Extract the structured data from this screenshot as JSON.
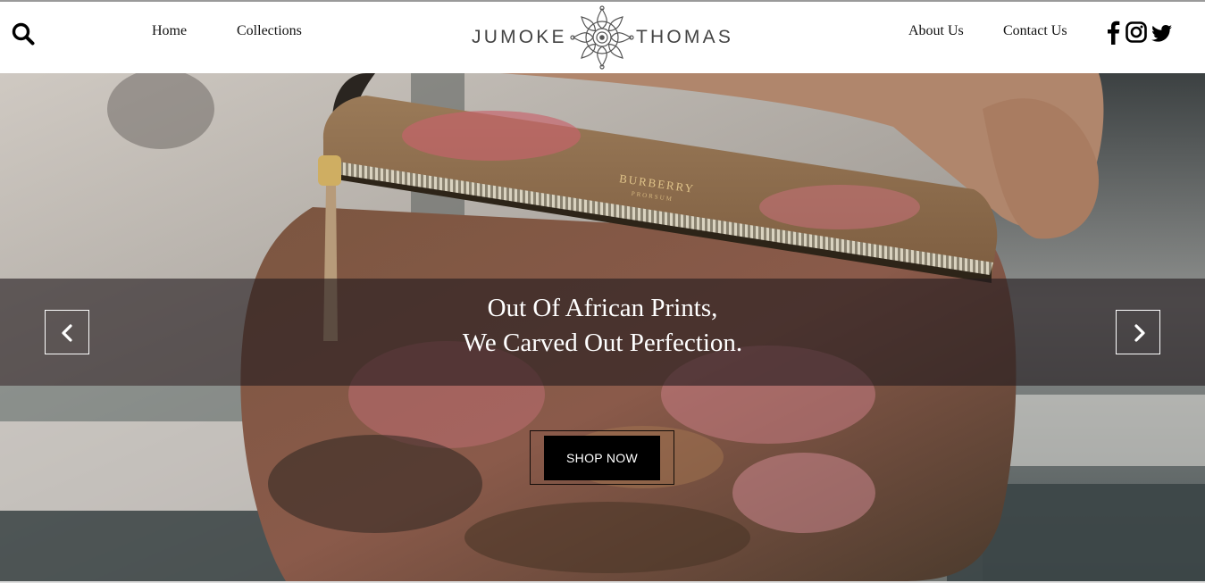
{
  "brand": {
    "left": "JUMOKE",
    "right": "THOMAS"
  },
  "nav": {
    "home": "Home",
    "collections": "Collections",
    "about": "About Us",
    "contact": "Contact Us"
  },
  "icons": {
    "search": "search-icon",
    "facebook": "facebook-icon",
    "instagram": "instagram-icon",
    "twitter": "twitter-icon",
    "prev": "chevron-left-icon",
    "next": "chevron-right-icon"
  },
  "hero": {
    "line1": "Out Of African Prints,",
    "line2": "We Carved Out Perfection.",
    "cta": "SHOP NOW",
    "bag_brand": "BURBERRY",
    "bag_sub": "PRORSUM"
  },
  "colors": {
    "logo": "#444444",
    "overlay": "#231c1e",
    "button": "#000000"
  }
}
